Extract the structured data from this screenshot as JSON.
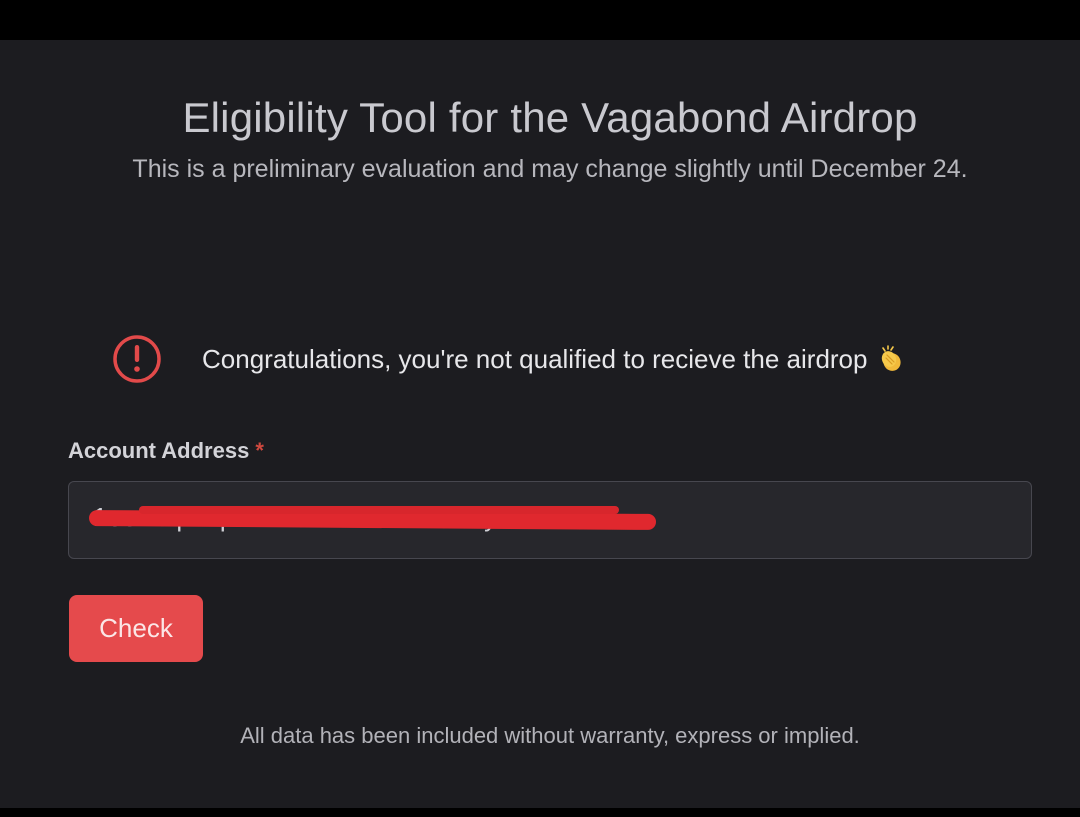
{
  "header": {
    "title": "Eligibility Tool for the Vagabond Airdrop",
    "subtitle": "This is a preliminary evaluation and may change slightly until December 24."
  },
  "alert": {
    "icon": "alert-circle-icon",
    "message": "Congratulations, you're not qualified to recieve the airdrop",
    "emoji": "clapping-hands-icon",
    "icon_color": "#e24a4a"
  },
  "form": {
    "label": "Account Address",
    "required_marker": "*",
    "address_value": "1oomTpoxpVRoDokdrSHiNSonby2WWrn3",
    "redacted": true,
    "button_label": "Check"
  },
  "footer": {
    "text": "All data has been included without warranty, express or implied."
  },
  "colors": {
    "background": "#1c1c20",
    "accent": "#e54a4c",
    "input_bg": "#27272c"
  }
}
